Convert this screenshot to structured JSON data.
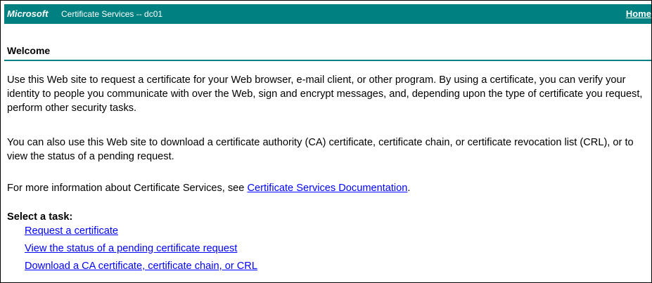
{
  "banner": {
    "brand": "Microsoft",
    "product": "Certificate Services  --  dc01",
    "home_link": "Home",
    "color": "#008080"
  },
  "welcome": {
    "title": "Welcome"
  },
  "body": {
    "paragraph1": "Use this Web site to request a certificate for your Web browser, e-mail client, or other program. By using a certificate, you can verify your identity to people you communicate with over the Web, sign and encrypt messages, and, depending upon the type of certificate you request, perform other security tasks.",
    "paragraph2": "You can also use this Web site to download a certificate authority (CA) certificate, certificate chain, or certificate revocation list (CRL), or to view the status of a pending request.",
    "paragraph3_prefix": "For more information about Certificate Services, see ",
    "paragraph3_link": "Certificate Services Documentation",
    "paragraph3_suffix": "."
  },
  "tasks": {
    "label": "Select a task:",
    "items": [
      "Request a certificate",
      "View the status of a pending certificate request",
      "Download a CA certificate, certificate chain, or CRL"
    ]
  },
  "colors": {
    "link": "#0000ff",
    "accent": "#008080"
  }
}
